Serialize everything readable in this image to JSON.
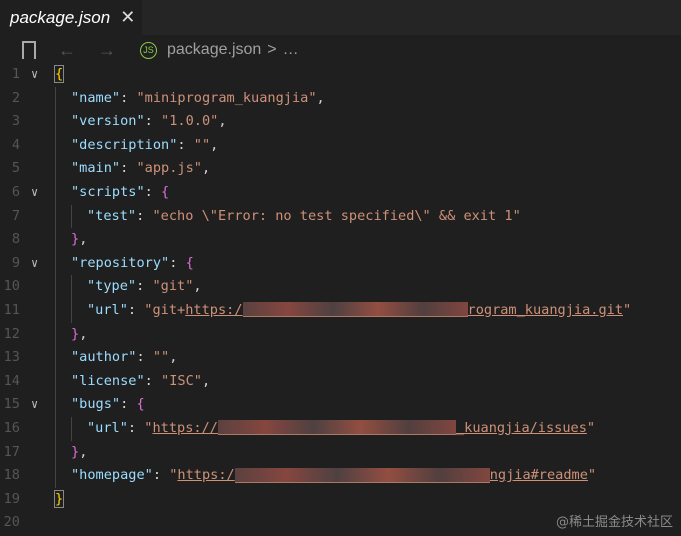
{
  "tab": {
    "title": "package.json",
    "close": "✕"
  },
  "breadcrumb": {
    "file": "package.json",
    "sep": ">",
    "more": "…",
    "back": "←",
    "forward": "→",
    "js": "JS"
  },
  "lines": [
    {
      "n": "1",
      "fold": true,
      "i": 0,
      "t": [
        [
          "b1 box",
          "{"
        ]
      ]
    },
    {
      "n": "2",
      "i": 1,
      "t": [
        [
          "k",
          "\"name\""
        ],
        [
          "p",
          ": "
        ],
        [
          "s",
          "\"miniprogram_kuangjia\""
        ],
        [
          "p",
          ","
        ]
      ]
    },
    {
      "n": "3",
      "i": 1,
      "t": [
        [
          "k",
          "\"version\""
        ],
        [
          "p",
          ": "
        ],
        [
          "s",
          "\"1.0.0\""
        ],
        [
          "p",
          ","
        ]
      ]
    },
    {
      "n": "4",
      "i": 1,
      "t": [
        [
          "k",
          "\"description\""
        ],
        [
          "p",
          ": "
        ],
        [
          "s",
          "\"\""
        ],
        [
          "p",
          ","
        ]
      ]
    },
    {
      "n": "5",
      "i": 1,
      "t": [
        [
          "k",
          "\"main\""
        ],
        [
          "p",
          ": "
        ],
        [
          "s",
          "\"app.js\""
        ],
        [
          "p",
          ","
        ]
      ]
    },
    {
      "n": "6",
      "fold": true,
      "i": 1,
      "t": [
        [
          "k",
          "\"scripts\""
        ],
        [
          "p",
          ": "
        ],
        [
          "b2",
          "{"
        ]
      ]
    },
    {
      "n": "7",
      "i": 2,
      "t": [
        [
          "k",
          "\"test\""
        ],
        [
          "p",
          ": "
        ],
        [
          "s",
          "\"echo \\\"Error: no test specified\\\" && exit 1\""
        ]
      ]
    },
    {
      "n": "8",
      "i": 1,
      "t": [
        [
          "b2",
          "}"
        ],
        [
          "p",
          ","
        ]
      ]
    },
    {
      "n": "9",
      "fold": true,
      "i": 1,
      "t": [
        [
          "k",
          "\"repository\""
        ],
        [
          "p",
          ": "
        ],
        [
          "b2",
          "{"
        ]
      ]
    },
    {
      "n": "10",
      "i": 2,
      "t": [
        [
          "k",
          "\"type\""
        ],
        [
          "p",
          ": "
        ],
        [
          "s",
          "\"git\""
        ],
        [
          "p",
          ","
        ]
      ]
    },
    {
      "n": "11",
      "i": 2,
      "t": [
        [
          "k",
          "\"url\""
        ],
        [
          "p",
          ": "
        ],
        [
          "s",
          "\"git+"
        ],
        [
          "s u",
          "https:/"
        ],
        [
          "red",
          ""
        ],
        [
          "s u",
          "rogram_kuangjia.git"
        ],
        [
          "s",
          "\""
        ]
      ]
    },
    {
      "n": "12",
      "i": 1,
      "t": [
        [
          "b2",
          "}"
        ],
        [
          "p",
          ","
        ]
      ]
    },
    {
      "n": "13",
      "i": 1,
      "t": [
        [
          "k",
          "\"author\""
        ],
        [
          "p",
          ": "
        ],
        [
          "s",
          "\"\""
        ],
        [
          "p",
          ","
        ]
      ]
    },
    {
      "n": "14",
      "i": 1,
      "t": [
        [
          "k",
          "\"license\""
        ],
        [
          "p",
          ": "
        ],
        [
          "s",
          "\"ISC\""
        ],
        [
          "p",
          ","
        ]
      ]
    },
    {
      "n": "15",
      "fold": true,
      "i": 1,
      "t": [
        [
          "k",
          "\"bugs\""
        ],
        [
          "p",
          ": "
        ],
        [
          "b2",
          "{"
        ]
      ]
    },
    {
      "n": "16",
      "i": 2,
      "t": [
        [
          "k",
          "\"url\""
        ],
        [
          "p",
          ": "
        ],
        [
          "s",
          "\""
        ],
        [
          "s u",
          "https://"
        ],
        [
          "red",
          ""
        ],
        [
          "s u",
          "_kuangjia/issues"
        ],
        [
          "s",
          "\""
        ]
      ]
    },
    {
      "n": "17",
      "i": 1,
      "t": [
        [
          "b2",
          "}"
        ],
        [
          "p",
          ","
        ]
      ]
    },
    {
      "n": "18",
      "i": 1,
      "t": [
        [
          "k",
          "\"homepage\""
        ],
        [
          "p",
          ": "
        ],
        [
          "s",
          "\""
        ],
        [
          "s u",
          "https:/"
        ],
        [
          "red",
          ""
        ],
        [
          "s u",
          "ngjia#readme"
        ],
        [
          "s",
          "\""
        ]
      ]
    },
    {
      "n": "19",
      "i": 0,
      "t": [
        [
          "b1 box",
          "}"
        ]
      ]
    },
    {
      "n": "20",
      "i": 0,
      "t": []
    }
  ],
  "watermark": "@稀土掘金技术社区"
}
